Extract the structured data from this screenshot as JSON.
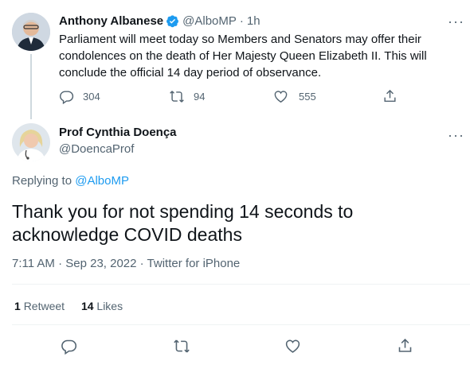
{
  "parent_tweet": {
    "author_name": "Anthony Albanese",
    "handle": "@AlboMP",
    "separator": "·",
    "time": "1h",
    "text": "Parliament will meet today so Members and Senators may offer their condolences on the death of Her Majesty Queen Elizabeth II. This will conclude the official 14 day period of observance.",
    "replies": "304",
    "retweets": "94",
    "likes": "555",
    "more_label": "···"
  },
  "main_tweet": {
    "author_name": "Prof Cynthia Doença",
    "handle": "@DoencaProf",
    "replying_prefix": "Replying to",
    "replying_handle": "@AlboMP",
    "text": "Thank you for not spending 14 seconds to acknowledge COVID deaths",
    "timestamp": "7:11 AM · Sep 23, 2022 · Twitter for iPhone",
    "retweet_count": "1",
    "retweet_label": "Retweet",
    "like_count": "14",
    "like_label": "Likes",
    "more_label": "···"
  },
  "colors": {
    "accent": "#1d9bf0",
    "text": "#0f1419",
    "muted": "#536471",
    "border": "#eff3f4"
  },
  "icons": [
    "verified-badge-icon",
    "reply-icon",
    "retweet-icon",
    "like-icon",
    "share-icon",
    "more-icon"
  ]
}
